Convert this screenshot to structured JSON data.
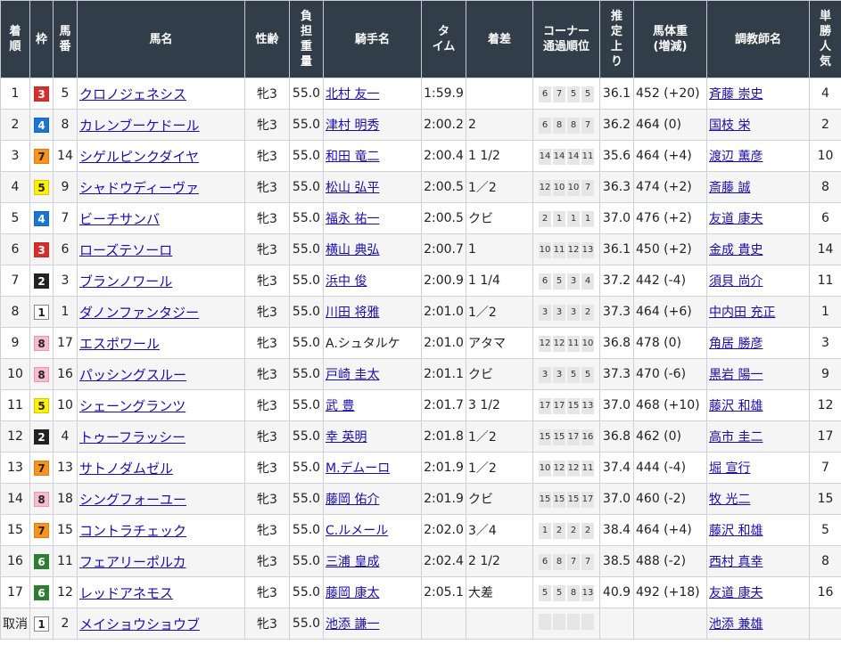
{
  "headers": {
    "rank": [
      "着",
      "順"
    ],
    "waku": "枠",
    "umaban": [
      "馬",
      "番"
    ],
    "horse": "馬名",
    "sexage": "性齢",
    "weight": [
      "負",
      "担",
      "重",
      "量"
    ],
    "jockey": "騎手名",
    "time": [
      "タ",
      "イム"
    ],
    "margin": "着差",
    "corner": [
      "コーナー",
      "通過順位"
    ],
    "last3f": [
      "推",
      "定",
      "上",
      "り"
    ],
    "bodyweight": [
      "馬体重",
      "(増減)"
    ],
    "trainer": "調教師名",
    "popularity": [
      "単",
      "勝",
      "人",
      "気"
    ]
  },
  "rows": [
    {
      "rank": "1",
      "waku": "3",
      "umaban": "5",
      "horse": "クロノジェネシス",
      "sexage": "牝3",
      "weight": "55.0",
      "jockey": "北村 友一",
      "time": "1:59.9",
      "margin": "",
      "corner": [
        "6",
        "7",
        "5",
        "5"
      ],
      "last3f": "36.1",
      "bodyweight": "452 (+20)",
      "trainer": "斉藤 崇史",
      "popularity": "4"
    },
    {
      "rank": "2",
      "waku": "4",
      "umaban": "8",
      "horse": "カレンブーケドール",
      "sexage": "牝3",
      "weight": "55.0",
      "jockey": "津村 明秀",
      "time": "2:00.2",
      "margin": "2",
      "corner": [
        "6",
        "8",
        "8",
        "7"
      ],
      "last3f": "36.2",
      "bodyweight": "464 (0)",
      "trainer": "国枝 栄",
      "popularity": "2"
    },
    {
      "rank": "3",
      "waku": "7",
      "umaban": "14",
      "horse": "シゲルピンクダイヤ",
      "sexage": "牝3",
      "weight": "55.0",
      "jockey": "和田 竜二",
      "time": "2:00.4",
      "margin": "1 1/2",
      "corner": [
        "14",
        "14",
        "14",
        "11"
      ],
      "last3f": "35.6",
      "bodyweight": "464 (+4)",
      "trainer": "渡辺 薫彦",
      "popularity": "10"
    },
    {
      "rank": "4",
      "waku": "5",
      "umaban": "9",
      "horse": "シャドウディーヴァ",
      "sexage": "牝3",
      "weight": "55.0",
      "jockey": "松山 弘平",
      "time": "2:00.5",
      "margin": "1／2",
      "corner": [
        "12",
        "10",
        "10",
        "7"
      ],
      "last3f": "36.3",
      "bodyweight": "474 (+2)",
      "trainer": "斎藤 誠",
      "popularity": "8"
    },
    {
      "rank": "5",
      "waku": "4",
      "umaban": "7",
      "horse": "ビーチサンバ",
      "sexage": "牝3",
      "weight": "55.0",
      "jockey": "福永 祐一",
      "time": "2:00.5",
      "margin": "クビ",
      "corner": [
        "2",
        "1",
        "1",
        "1"
      ],
      "last3f": "37.0",
      "bodyweight": "476 (+2)",
      "trainer": "友道 康夫",
      "popularity": "6"
    },
    {
      "rank": "6",
      "waku": "3",
      "umaban": "6",
      "horse": "ローズテソーロ",
      "sexage": "牝3",
      "weight": "55.0",
      "jockey": "横山 典弘",
      "time": "2:00.7",
      "margin": "1",
      "corner": [
        "10",
        "11",
        "12",
        "13"
      ],
      "last3f": "36.1",
      "bodyweight": "450 (+2)",
      "trainer": "金成 貴史",
      "popularity": "14"
    },
    {
      "rank": "7",
      "waku": "2",
      "umaban": "3",
      "horse": "ブランノワール",
      "sexage": "牝3",
      "weight": "55.0",
      "jockey": "浜中 俊",
      "time": "2:00.9",
      "margin": "1 1/4",
      "corner": [
        "6",
        "5",
        "3",
        "4"
      ],
      "last3f": "37.2",
      "bodyweight": "442 (-4)",
      "trainer": "須貝 尚介",
      "popularity": "11"
    },
    {
      "rank": "8",
      "waku": "1",
      "umaban": "1",
      "horse": "ダノンファンタジー",
      "sexage": "牝3",
      "weight": "55.0",
      "jockey": "川田 将雅",
      "time": "2:01.0",
      "margin": "1／2",
      "corner": [
        "3",
        "3",
        "3",
        "2"
      ],
      "last3f": "37.3",
      "bodyweight": "464 (+6)",
      "trainer": "中内田 充正",
      "popularity": "1"
    },
    {
      "rank": "9",
      "waku": "8",
      "umaban": "17",
      "horse": "エスポワール",
      "sexage": "牝3",
      "weight": "55.0",
      "jockey": "A.シュタルケ",
      "time": "2:01.0",
      "margin": "アタマ",
      "corner": [
        "12",
        "12",
        "11",
        "10"
      ],
      "last3f": "36.8",
      "bodyweight": "478 (0)",
      "trainer": "角居 勝彦",
      "popularity": "3"
    },
    {
      "rank": "10",
      "waku": "8",
      "umaban": "16",
      "horse": "パッシングスルー",
      "sexage": "牝3",
      "weight": "55.0",
      "jockey": "戸崎 圭太",
      "time": "2:01.1",
      "margin": "クビ",
      "corner": [
        "3",
        "3",
        "5",
        "5"
      ],
      "last3f": "37.3",
      "bodyweight": "470 (-6)",
      "trainer": "黒岩 陽一",
      "popularity": "9"
    },
    {
      "rank": "11",
      "waku": "5",
      "umaban": "10",
      "horse": "シェーングランツ",
      "sexage": "牝3",
      "weight": "55.0",
      "jockey": "武 豊",
      "time": "2:01.7",
      "margin": "3 1/2",
      "corner": [
        "17",
        "17",
        "15",
        "13"
      ],
      "last3f": "37.0",
      "bodyweight": "468 (+10)",
      "trainer": "藤沢 和雄",
      "popularity": "12"
    },
    {
      "rank": "12",
      "waku": "2",
      "umaban": "4",
      "horse": "トゥーフラッシー",
      "sexage": "牝3",
      "weight": "55.0",
      "jockey": "幸 英明",
      "time": "2:01.8",
      "margin": "1／2",
      "corner": [
        "15",
        "15",
        "17",
        "16"
      ],
      "last3f": "36.8",
      "bodyweight": "462 (0)",
      "trainer": "高市 圭二",
      "popularity": "17"
    },
    {
      "rank": "13",
      "waku": "7",
      "umaban": "13",
      "horse": "サトノダムゼル",
      "sexage": "牝3",
      "weight": "55.0",
      "jockey": "M.デムーロ",
      "time": "2:01.9",
      "margin": "1／2",
      "corner": [
        "10",
        "12",
        "12",
        "11"
      ],
      "last3f": "37.4",
      "bodyweight": "444 (-4)",
      "trainer": "堀 宣行",
      "popularity": "7"
    },
    {
      "rank": "14",
      "waku": "8",
      "umaban": "18",
      "horse": "シングフォーユー",
      "sexage": "牝3",
      "weight": "55.0",
      "jockey": "藤岡 佑介",
      "time": "2:01.9",
      "margin": "クビ",
      "corner": [
        "15",
        "15",
        "15",
        "17"
      ],
      "last3f": "37.0",
      "bodyweight": "460 (-2)",
      "trainer": "牧 光二",
      "popularity": "15"
    },
    {
      "rank": "15",
      "waku": "7",
      "umaban": "15",
      "horse": "コントラチェック",
      "sexage": "牝3",
      "weight": "55.0",
      "jockey": "C.ルメール",
      "time": "2:02.0",
      "margin": "3／4",
      "corner": [
        "1",
        "2",
        "2",
        "2"
      ],
      "last3f": "38.4",
      "bodyweight": "464 (+4)",
      "trainer": "藤沢 和雄",
      "popularity": "5"
    },
    {
      "rank": "16",
      "waku": "6",
      "umaban": "11",
      "horse": "フェアリーポルカ",
      "sexage": "牝3",
      "weight": "55.0",
      "jockey": "三浦 皇成",
      "time": "2:02.4",
      "margin": "2 1/2",
      "corner": [
        "6",
        "8",
        "7",
        "7"
      ],
      "last3f": "38.5",
      "bodyweight": "488 (-2)",
      "trainer": "西村 真幸",
      "popularity": "8"
    },
    {
      "rank": "17",
      "waku": "6",
      "umaban": "12",
      "horse": "レッドアネモス",
      "sexage": "牝3",
      "weight": "55.0",
      "jockey": "藤岡 康太",
      "time": "2:05.1",
      "margin": "大差",
      "corner": [
        "5",
        "5",
        "8",
        "13"
      ],
      "last3f": "40.9",
      "bodyweight": "492 (+18)",
      "trainer": "友道 康夫",
      "popularity": "16"
    },
    {
      "rank": "取消",
      "waku": "1",
      "umaban": "2",
      "horse": "メイショウショウブ",
      "sexage": "牝3",
      "weight": "55.0",
      "jockey": "池添 謙一",
      "time": "",
      "margin": "",
      "corner": [
        "",
        "",
        "",
        ""
      ],
      "last3f": "",
      "bodyweight": "",
      "trainer": "池添 兼雄",
      "popularity": ""
    }
  ]
}
